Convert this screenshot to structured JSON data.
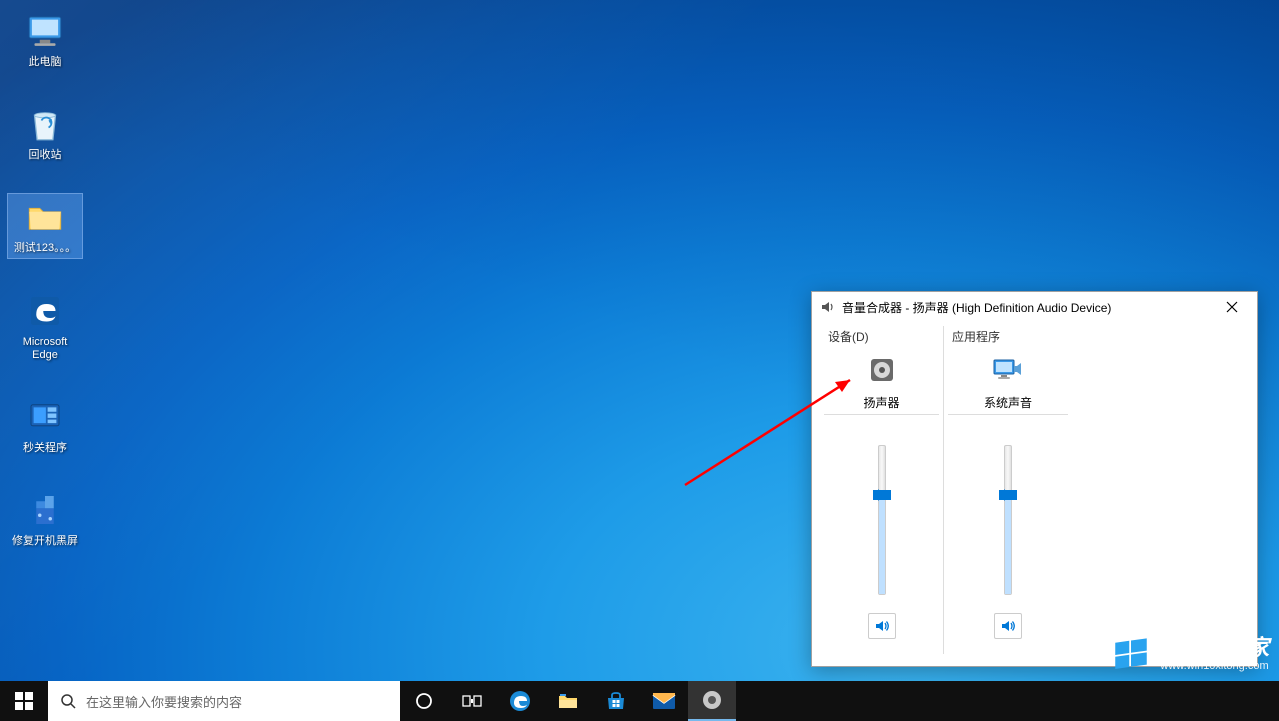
{
  "desktop": {
    "icons": [
      {
        "id": "this-pc",
        "label": "此电脑"
      },
      {
        "id": "recycle",
        "label": "回收站"
      },
      {
        "id": "folder",
        "label": "测试123。。。",
        "selected": true
      },
      {
        "id": "edge",
        "label": "Microsoft Edge"
      },
      {
        "id": "shutdown",
        "label": "秒关程序"
      },
      {
        "id": "repair",
        "label": "修复开机黑屏"
      }
    ]
  },
  "mixer": {
    "title": "音量合成器 - 扬声器 (High Definition Audio Device)",
    "device_header": "设备(D)",
    "apps_header": "应用程序",
    "device_label": "扬声器",
    "system_sounds_label": "系统声音",
    "device_volume_percent": 70,
    "system_volume_percent": 70
  },
  "taskbar": {
    "search_placeholder": "在这里输入你要搜索的内容"
  },
  "watermark": {
    "title": "Win10之家",
    "url": "www.win10xitong.com"
  },
  "colors": {
    "accent": "#0078d7"
  }
}
